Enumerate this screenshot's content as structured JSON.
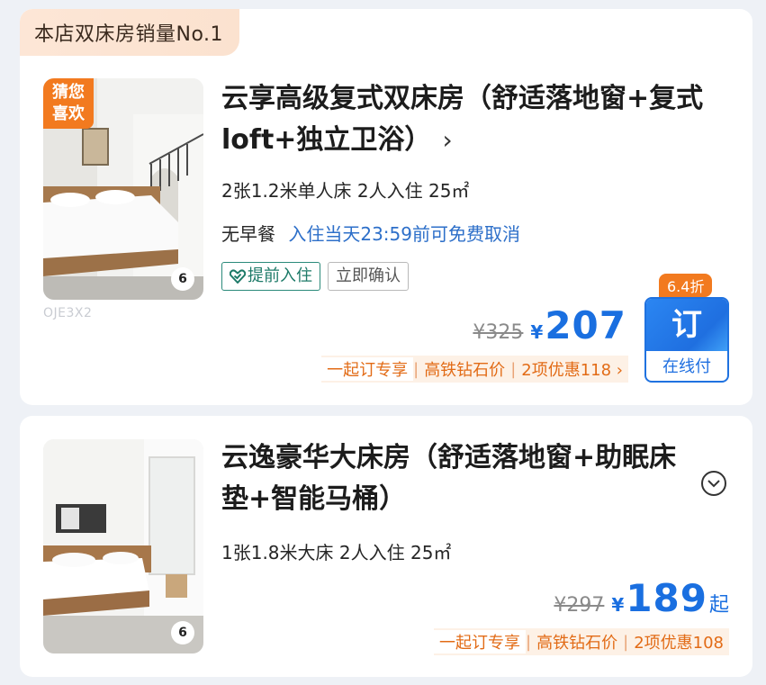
{
  "rooms": [
    {
      "sales_badge": "本店双床房销量No.1",
      "fav_badge": [
        "猜您",
        "喜欢"
      ],
      "image_count": "6",
      "room_code": "OJE3X2",
      "title": "云享高级复式双床房（舒适落地窗+复式loft+独立卫浴）",
      "title_icon": "chevron-right-icon",
      "info": "2张1.2米单人床 2人入住 25㎡",
      "breakfast": "无早餐",
      "cancel_policy": "入住当天23:59前可免费取消",
      "tags": [
        "提前入住",
        "立即确认"
      ],
      "original_price": "¥325",
      "currency": "¥",
      "price": "207",
      "promos": [
        "一起订专享",
        "高铁钻石价",
        "2项优惠118 ›"
      ],
      "discount": "6.4折",
      "book_button": {
        "top": "订",
        "bottom": "在线付"
      },
      "colors": {
        "accent": "#1a6fe0",
        "promo": "#e26b16",
        "badge": "#f27a1f"
      }
    },
    {
      "image_count": "6",
      "title": "云逸豪华大床房（舒适落地窗+助眠床垫+智能马桶）",
      "title_icon": "chevron-down-circle-icon",
      "info": "1张1.8米大床 2人入住 25㎡",
      "original_price": "¥297",
      "currency": "¥",
      "price": "189",
      "price_suffix": "起",
      "promos": [
        "一起订专享",
        "高铁钻石价",
        "2项优惠108"
      ]
    }
  ]
}
